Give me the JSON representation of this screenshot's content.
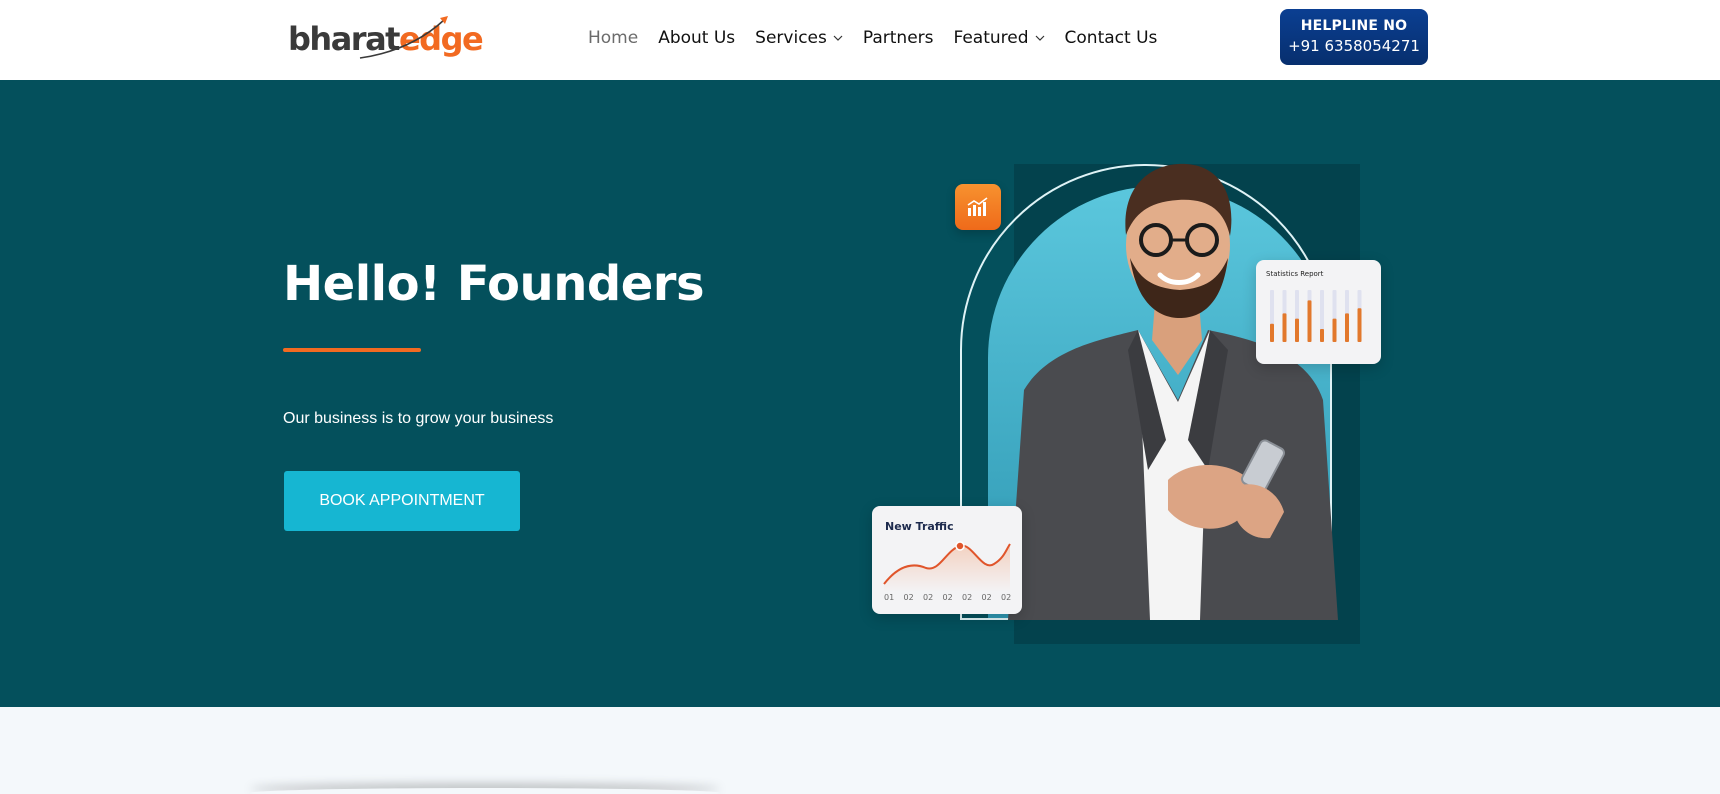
{
  "brand": {
    "logo_part1": "bharat",
    "logo_part2": "edge",
    "colors": {
      "dark": "#3a3a3a",
      "accent": "#f26a21",
      "hero_bg": "#04505c",
      "cta": "#16b6d2",
      "helpline_bg": "#0b3f92"
    }
  },
  "nav": {
    "items": [
      {
        "label": "Home",
        "active": true,
        "dropdown": false
      },
      {
        "label": "About Us",
        "active": false,
        "dropdown": false
      },
      {
        "label": "Services",
        "active": false,
        "dropdown": true
      },
      {
        "label": "Partners",
        "active": false,
        "dropdown": false
      },
      {
        "label": "Featured",
        "active": false,
        "dropdown": true
      },
      {
        "label": "Contact Us",
        "active": false,
        "dropdown": false
      }
    ]
  },
  "helpline": {
    "title": "HELPLINE NO",
    "number": "+91 6358054271"
  },
  "hero": {
    "title": "Hello! Founders",
    "subtitle": "Our business is to grow your business",
    "cta_label": "BOOK APPOINTMENT"
  },
  "illustration": {
    "stats_card_title": "Statistics Report",
    "stats_bars": [
      0.35,
      0.55,
      0.45,
      0.8,
      0.25,
      0.45,
      0.55,
      0.65
    ],
    "traffic_card_title": "New Traffic",
    "traffic_ticks": [
      "01",
      "02",
      "02",
      "02",
      "02",
      "02",
      "02"
    ]
  }
}
